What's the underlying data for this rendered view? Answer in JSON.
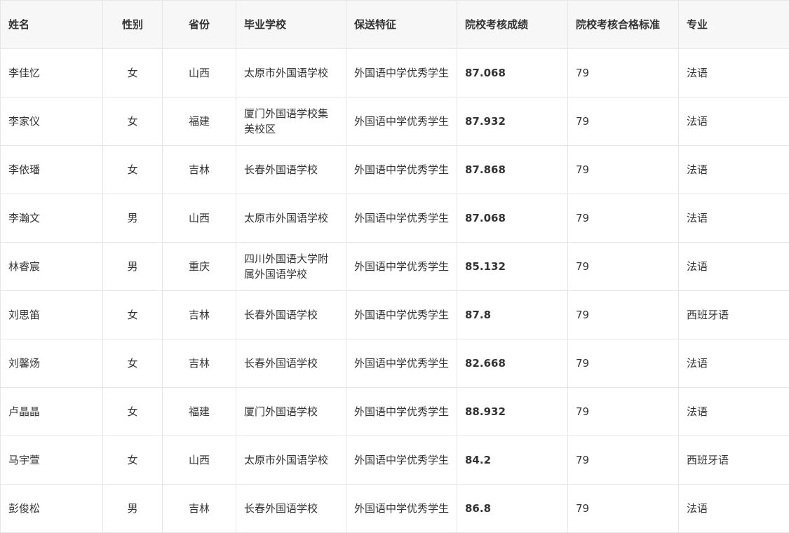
{
  "table": {
    "headers": [
      "姓名",
      "性别",
      "省份",
      "毕业学校",
      "保送特征",
      "院校考核成绩",
      "院校考核合格标准",
      "专业"
    ],
    "rows": [
      [
        "李佳忆",
        "女",
        "山西",
        "太原市外国语学校",
        "外国语中学优秀学生",
        "87.068",
        "79",
        "法语"
      ],
      [
        "李家仪",
        "女",
        "福建",
        "厦门外国语学校集美校区",
        "外国语中学优秀学生",
        "87.932",
        "79",
        "法语"
      ],
      [
        "李依璠",
        "女",
        "吉林",
        "长春外国语学校",
        "外国语中学优秀学生",
        "87.868",
        "79",
        "法语"
      ],
      [
        "李瀚文",
        "男",
        "山西",
        "太原市外国语学校",
        "外国语中学优秀学生",
        "87.068",
        "79",
        "法语"
      ],
      [
        "林睿宸",
        "男",
        "重庆",
        "四川外国语大学附属外国语学校",
        "外国语中学优秀学生",
        "85.132",
        "79",
        "法语"
      ],
      [
        "刘思笛",
        "女",
        "吉林",
        "长春外国语学校",
        "外国语中学优秀学生",
        "87.8",
        "79",
        "西班牙语"
      ],
      [
        "刘馨炀",
        "女",
        "吉林",
        "长春外国语学校",
        "外国语中学优秀学生",
        "82.668",
        "79",
        "法语"
      ],
      [
        "卢晶晶",
        "女",
        "福建",
        "厦门外国语学校",
        "外国语中学优秀学生",
        "88.932",
        "79",
        "法语"
      ],
      [
        "马宇萱",
        "女",
        "山西",
        "太原市外国语学校",
        "外国语中学优秀学生",
        "84.2",
        "79",
        "西班牙语"
      ],
      [
        "彭俊松",
        "男",
        "吉林",
        "长春外国语学校",
        "外国语中学优秀学生",
        "86.8",
        "79",
        "法语"
      ]
    ]
  }
}
